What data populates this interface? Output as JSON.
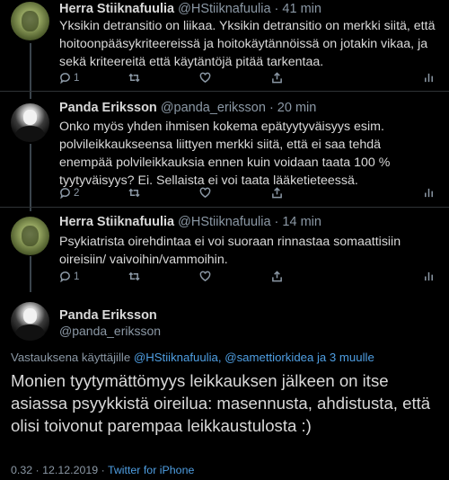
{
  "tweets": [
    {
      "name": "Herra Stiiknafuulia",
      "handle_time": "@HStiiknafuulia · 41 min",
      "text": "Yksikin detransitio on liikaa. Yksikin detransitio on merkki siitä, että hoitoonpääsykriteereissä ja hoitokäytännöissä on jotakin vikaa, ja sekä kriteereitä että käytäntöjä pitää tarkentaa.",
      "replies": "1",
      "retweets": "",
      "likes": ""
    },
    {
      "name": "Panda Eriksson",
      "handle_time": "@panda_eriksson · 20 min",
      "text": "Onko myös yhden ihmisen kokema epätyytyväisyys esim. polvileikkaukseensa liittyen merkki siitä, että ei saa tehdä enempää polvileikkauksia ennen kuin voidaan taata 100 % tyytyväisyys? Ei. Sellaista ei voi taata lääketieteessä.",
      "replies": "2",
      "retweets": "",
      "likes": ""
    },
    {
      "name": "Herra Stiiknafuulia",
      "handle_time": "@HStiiknafuulia · 14 min",
      "text": "Psykiatrista oirehdintaa ei voi suoraan rinnastaa somaattisiin oireisiin/ vaivoihin/vammoihin.",
      "replies": "1",
      "retweets": "",
      "likes": ""
    }
  ],
  "main": {
    "name": "Panda Eriksson",
    "handle": "@panda_eriksson",
    "reply_prefix": "Vastauksena käyttäjille ",
    "reply_mentions": "@HStiiknafuulia, @samettiorkidea ja 3 muulle",
    "text": "Monien tyytymättömyys leikkauksen jälkeen on itse asiassa psyykkistä oireilua: masennusta, ahdistusta, että olisi toivonut parempaa leikkaustulosta :)",
    "timestamp": "0.32 · 12.12.2019 · ",
    "client": "Twitter for iPhone"
  },
  "colors": {
    "background": "#000000",
    "text": "#d9d9d9",
    "muted": "#8b98a5",
    "link": "#4f9fe3"
  }
}
